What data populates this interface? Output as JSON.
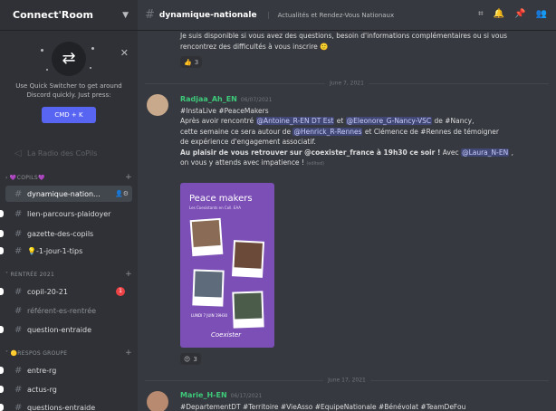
{
  "server": {
    "name": "Connect'Room"
  },
  "quick_switcher": {
    "text": "Use Quick Switcher to get around Discord quickly. Just press:",
    "shortcut": "CMD + K"
  },
  "sidebar": {
    "partial_channel": "La Radio des CoPils",
    "categories": [
      {
        "label": "COPILS",
        "emoji": "💜"
      },
      {
        "label": "RENTRÉE 2021"
      },
      {
        "label": "RESPOS GROUPE",
        "emoji": "🟡"
      }
    ],
    "channels": [
      {
        "label": "dynamique-nation..."
      },
      {
        "label": "lien-parcours-plaidoyer"
      },
      {
        "label": "gazette-des-copils"
      },
      {
        "label": "-1-jour-1-tips",
        "emoji": "💡"
      },
      {
        "label": "copil-20-21",
        "badge": "1"
      },
      {
        "label": "référent-es-rentrée"
      },
      {
        "label": "question-entraide"
      },
      {
        "label": "entre-rg"
      },
      {
        "label": "actus-rg"
      },
      {
        "label": "questions-entraide"
      }
    ]
  },
  "channel": {
    "name": "dynamique-nationale",
    "topic": "Actualités et Rendez-Vous Nationaux"
  },
  "messages": {
    "prev_text": "Je suis disponible si vous avez des questions, besoin d'informations complémentaires ou si vous rencontrez des difficultés à vous inscrire",
    "prev_reaction_count": "3",
    "date1": "June 7, 2021",
    "m1": {
      "author": "Radjaa_Ah_EN",
      "time": "06/07/2021",
      "l1": "#InstaLive #PeaceMakers",
      "l2a": "Après avoir rencontré",
      "mention1": "@Antoine_R-EN DT Est",
      "l2b": "et",
      "mention2": "@Eleonore_G-Nancy-VSC",
      "l2c": "de #Nancy,",
      "l3a": "cette semaine ce sera autour de",
      "mention3": "@Henrick_R-Rennes",
      "l3b": "et Clémence de #Rennes de témoigner",
      "l4": "de expérience d'engagement associatif.",
      "l5a": "Au plaisir de vous retrouver sur @coexister_france à 19h30 ce soir !",
      "l5b": "Avec",
      "mention4": "@Laura_N-EN",
      "l6": "on vous y attends avec impatience !",
      "edited": "(edited)",
      "reaction_count": "3"
    },
    "poster": {
      "title": "Peace makers",
      "subtitle": "Les Coexistants en Coll. EAA",
      "date": "LUNDI 7 JUIN 19H30",
      "logo": "Coexister"
    },
    "date2": "June 17, 2021",
    "m2": {
      "author": "Marie_H-EN",
      "time": "06/17/2021",
      "text": "#DepartementDT #Territoire #VieAsso #EquipeNationale #Bénévolat #TeamDeFou"
    }
  }
}
